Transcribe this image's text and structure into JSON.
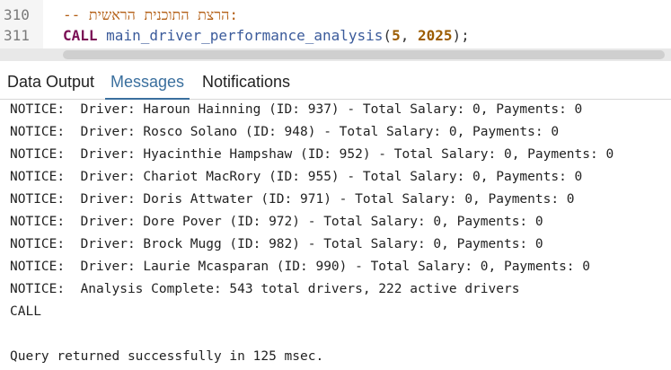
{
  "editor": {
    "lines": [
      {
        "number": "310",
        "text": "-- הרצת התוכנית הראשית:"
      },
      {
        "number": "311",
        "keyword": "CALL",
        "function": "main_driver_performance_analysis",
        "open": "(",
        "arg1": "5",
        "sep": ", ",
        "arg2": "2025",
        "close": ");"
      }
    ]
  },
  "tabs": [
    {
      "label": "Data Output",
      "active": false
    },
    {
      "label": "Messages",
      "active": true
    },
    {
      "label": "Notifications",
      "active": false
    }
  ],
  "messages": [
    "NOTICE:  Driver: Haroun Hainning (ID: 937) - Total Salary: 0, Payments: 0",
    "NOTICE:  Driver: Rosco Solano (ID: 948) - Total Salary: 0, Payments: 0",
    "NOTICE:  Driver: Hyacinthie Hampshaw (ID: 952) - Total Salary: 0, Payments: 0",
    "NOTICE:  Driver: Chariot MacRory (ID: 955) - Total Salary: 0, Payments: 0",
    "NOTICE:  Driver: Doris Attwater (ID: 971) - Total Salary: 0, Payments: 0",
    "NOTICE:  Driver: Dore Pover (ID: 972) - Total Salary: 0, Payments: 0",
    "NOTICE:  Driver: Brock Mugg (ID: 982) - Total Salary: 0, Payments: 0",
    "NOTICE:  Driver: Laurie Mcasparan (ID: 990) - Total Salary: 0, Payments: 0",
    "NOTICE:  Analysis Complete: 543 total drivers, 222 active drivers",
    "CALL",
    "",
    "Query returned successfully in 125 msec."
  ],
  "colors": {
    "accent": "#3a6f9e",
    "keyword": "#7a0f55",
    "comment": "#b35e14"
  }
}
